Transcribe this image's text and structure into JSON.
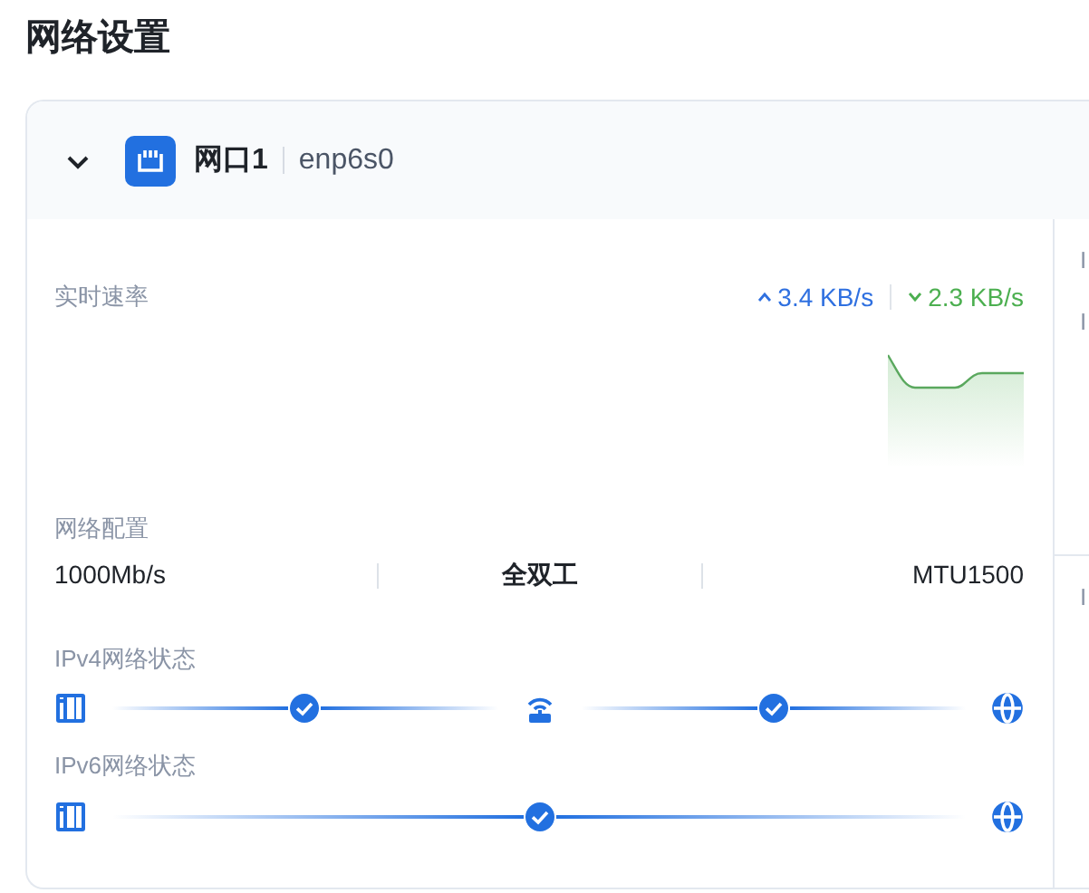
{
  "page_title": "网络设置",
  "interface": {
    "expanded": true,
    "name": "网口1",
    "device": "enp6s0"
  },
  "rate": {
    "label": "实时速率",
    "upload": "3.4 KB/s",
    "download": "2.3 KB/s"
  },
  "config": {
    "label": "网络配置",
    "speed": "1000Mb/s",
    "duplex": "全双工",
    "mtu": "MTU1500"
  },
  "status": [
    {
      "label": "IPv4网络状态",
      "nodes": [
        {
          "kind": "device"
        },
        {
          "kind": "link",
          "ok": true
        },
        {
          "kind": "router"
        },
        {
          "kind": "link",
          "ok": true
        },
        {
          "kind": "internet"
        }
      ]
    },
    {
      "label": "IPv6网络状态",
      "nodes": [
        {
          "kind": "device"
        },
        {
          "kind": "link",
          "ok": true
        },
        {
          "kind": "internet"
        }
      ]
    }
  ],
  "side_groups": [
    [
      "I",
      "I"
    ],
    [
      "I"
    ]
  ]
}
